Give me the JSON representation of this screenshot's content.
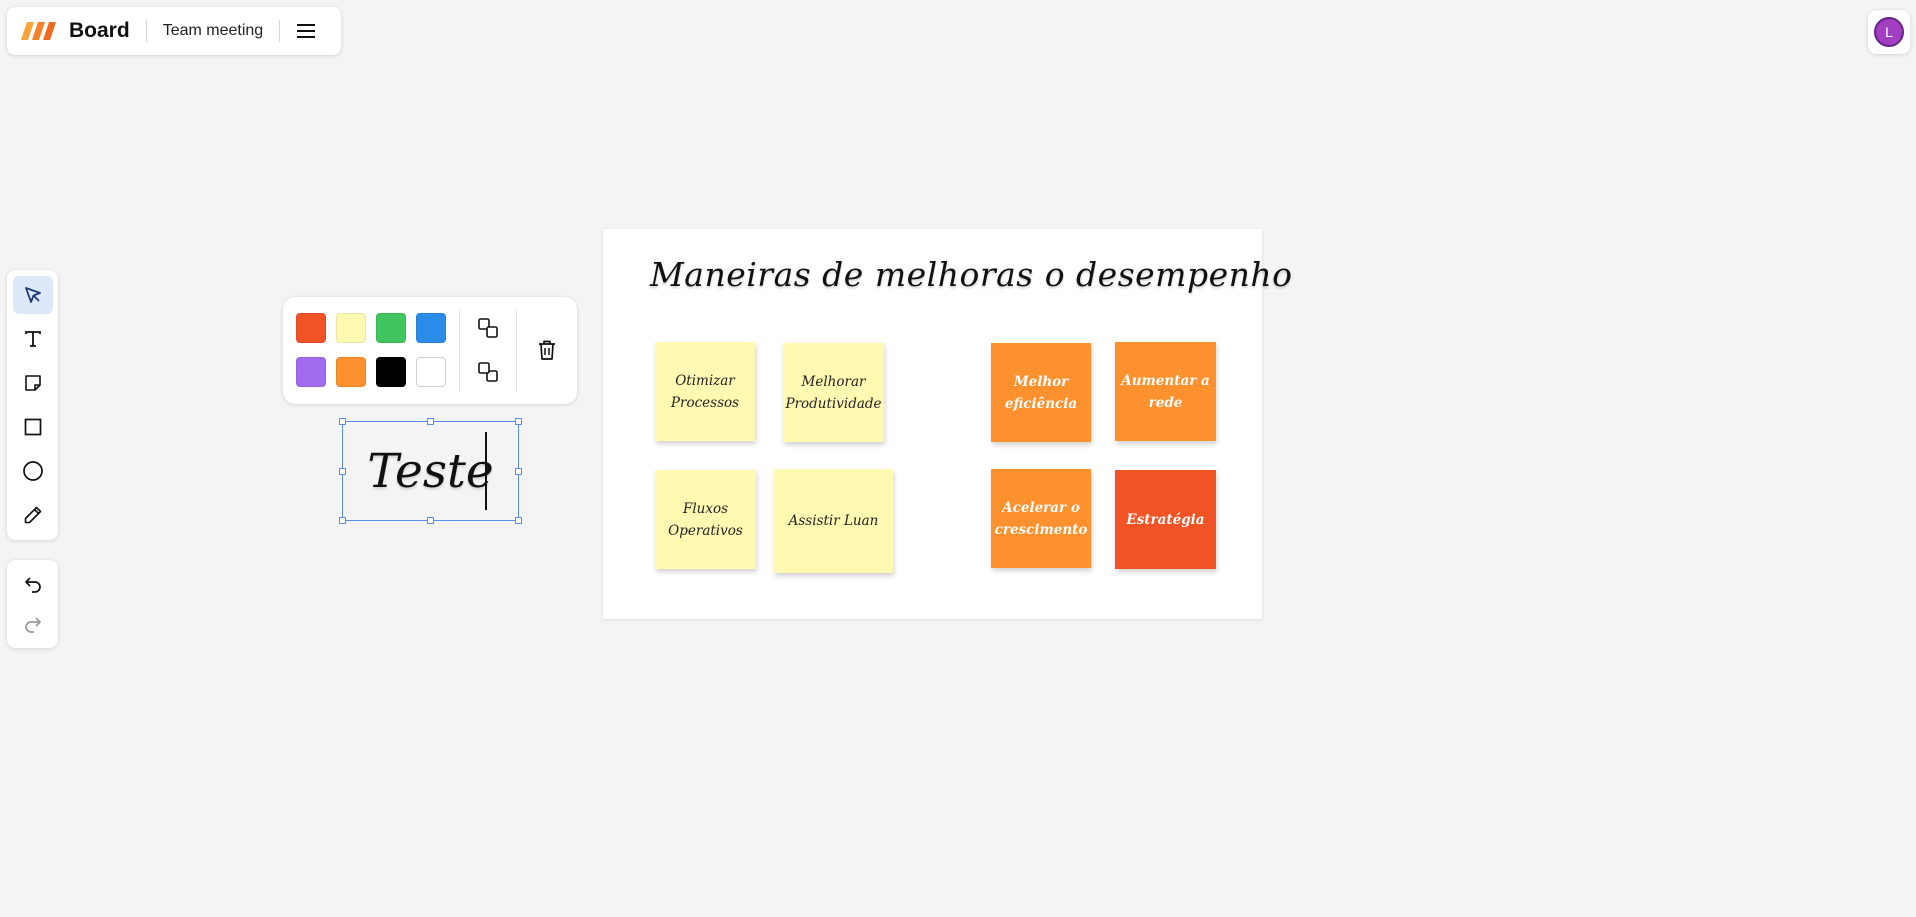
{
  "app": {
    "name": "Board",
    "board_name": "Team meeting",
    "menu_icon": "hamburger-menu-icon",
    "logo_colors": [
      "#f8a33a",
      "#f5822a",
      "#ef6a1f"
    ]
  },
  "user": {
    "avatar_initial": "L",
    "avatar_color": "#a13fc0"
  },
  "toolbar": {
    "tools": [
      {
        "name": "select",
        "icon": "cursor-arrow-icon",
        "active": true
      },
      {
        "name": "text",
        "icon": "text-icon",
        "active": false
      },
      {
        "name": "sticky-note",
        "icon": "sticky-note-icon",
        "active": false
      },
      {
        "name": "rectangle",
        "icon": "square-icon",
        "active": false
      },
      {
        "name": "ellipse",
        "icon": "circle-icon",
        "active": false
      },
      {
        "name": "pen",
        "icon": "pencil-icon",
        "active": false
      }
    ],
    "history": [
      {
        "name": "undo",
        "icon": "undo-icon",
        "enabled": true
      },
      {
        "name": "redo",
        "icon": "redo-icon",
        "enabled": false
      }
    ]
  },
  "color_popover": {
    "colors": [
      "#f25325",
      "#fff9b1",
      "#41c55e",
      "#2a8ce8",
      "#a16bf0",
      "#fd912d",
      "#000000",
      "#ffffff"
    ],
    "actions": [
      {
        "name": "bring-to-front",
        "icon": "bring-forward-icon"
      },
      {
        "name": "send-to-back",
        "icon": "send-backward-icon"
      },
      {
        "name": "delete",
        "icon": "trash-icon"
      }
    ]
  },
  "selected_text": {
    "value": "Teste"
  },
  "frame": {
    "title": "Maneiras de melhoras o desempenho",
    "notes": [
      {
        "text": "Otimizar Processos",
        "color": "yellow"
      },
      {
        "text": "Melhorar Produtividade",
        "color": "yellow"
      },
      {
        "text": "Fluxos Operativos",
        "color": "yellow"
      },
      {
        "text": "Assistir Luan",
        "color": "yellow"
      },
      {
        "text": "Melhor eficiência",
        "color": "orange"
      },
      {
        "text": "Aumentar a rede",
        "color": "orange"
      },
      {
        "text": "Acelerar o crescimento",
        "color": "orange"
      },
      {
        "text": "Estratégia",
        "color": "red"
      }
    ]
  }
}
